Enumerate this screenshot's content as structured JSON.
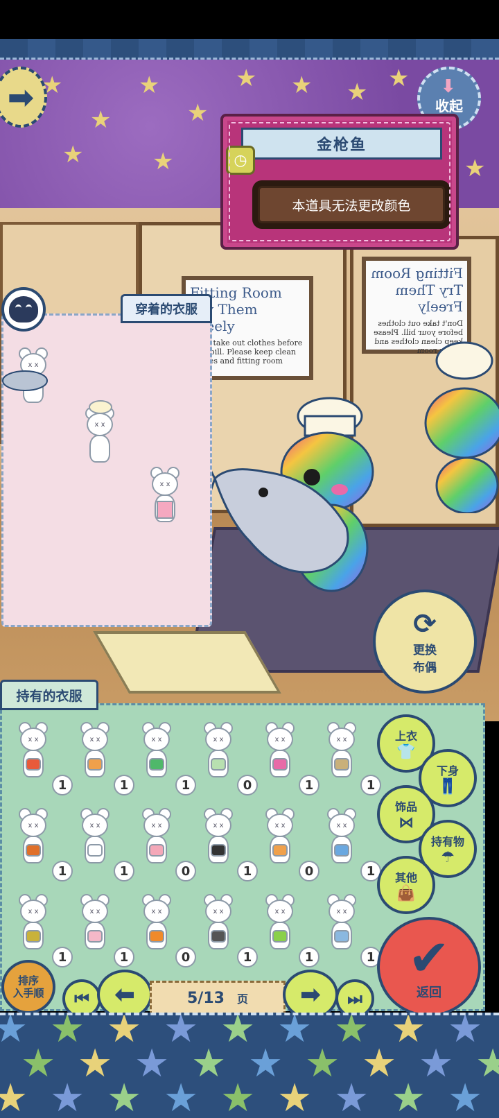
{
  "header": {
    "collapse_label": "收起"
  },
  "item_info": {
    "name": "金枪鱼",
    "note": "本道具无法更改颜色"
  },
  "worn_panel": {
    "title": "穿着的衣服"
  },
  "owned_panel": {
    "title": "持有的衣服",
    "items": [
      {
        "accessory": "fire-hat",
        "count": "1"
      },
      {
        "accessory": "ice-cream-cone",
        "count": "1"
      },
      {
        "accessory": "leaf",
        "count": "1"
      },
      {
        "accessory": "green-dress",
        "count": "0"
      },
      {
        "accessory": "pink-doll",
        "count": "1"
      },
      {
        "accessory": "trumpet",
        "count": "1"
      },
      {
        "accessory": "basketball",
        "count": "1"
      },
      {
        "accessory": "angel-wings",
        "count": "1"
      },
      {
        "accessory": "blush",
        "count": "0"
      },
      {
        "accessory": "black-skirt",
        "count": "1"
      },
      {
        "accessory": "orange-apron",
        "count": "0"
      },
      {
        "accessory": "party-hat",
        "count": "1"
      },
      {
        "accessory": "grass-skirt",
        "count": "1"
      },
      {
        "accessory": "pink-kimono",
        "count": "1"
      },
      {
        "accessory": "orange-bowtie",
        "count": "0"
      },
      {
        "accessory": "camera",
        "count": "1"
      },
      {
        "accessory": "green-vest",
        "count": "1"
      },
      {
        "accessory": "blue-cap",
        "count": "1"
      }
    ]
  },
  "categories": {
    "tops": "上衣",
    "bottoms": "下身",
    "accessories": "饰品",
    "held_items": "持有物",
    "others": "其他"
  },
  "change_doll": {
    "line1": "更换",
    "line2": "布偶"
  },
  "confirm": {
    "label": "返回"
  },
  "sort": {
    "line1": "排序",
    "line2": "入手顺"
  },
  "pager": {
    "current": "5/13",
    "unit": "页"
  },
  "room": {
    "sign_title": "Fitting Room",
    "sign_subtitle": "Try Them Freely",
    "sign_text": "Don't take out clothes before your bill. Please keep clean clothes and fitting room"
  },
  "colors": {
    "accent": "#2b4a72",
    "panel_pink": "#b8347a",
    "panel_green": "#a8d7b9",
    "wall_purple": "#7a4aa2"
  }
}
